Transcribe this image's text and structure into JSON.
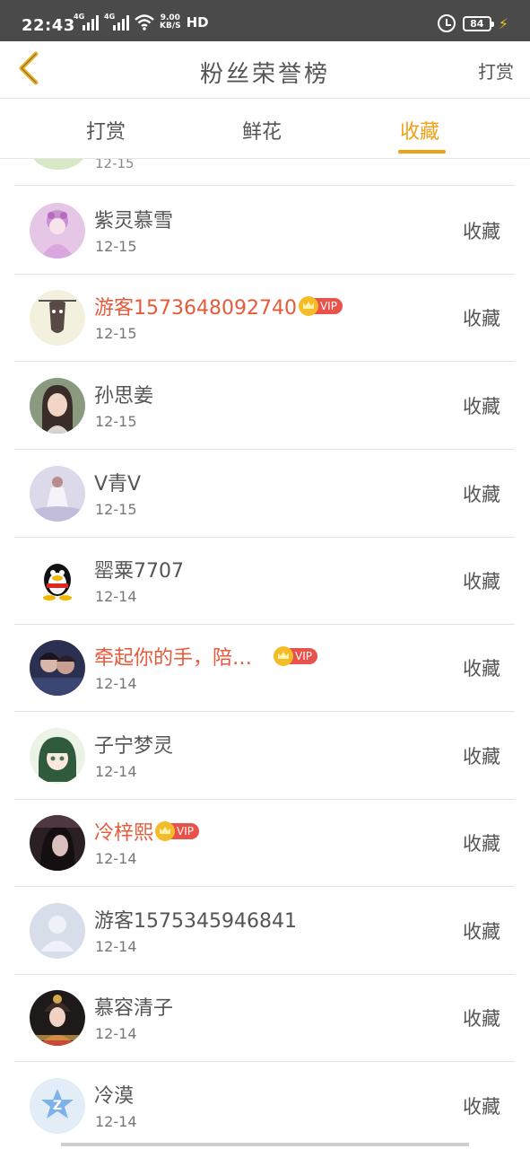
{
  "status_bar": {
    "time": "22:43",
    "net1": "4G",
    "net2": "4G",
    "speed_top": "9.00",
    "speed_bottom": "KB/S",
    "hd": "HD",
    "battery": "84"
  },
  "header": {
    "title": "粉丝荣誉榜",
    "action": "打赏"
  },
  "tabs": [
    {
      "label": "打赏"
    },
    {
      "label": "鲜花"
    },
    {
      "label": "收藏",
      "active": true
    }
  ],
  "colors": {
    "accent": "#f0a015",
    "vip_name": "#e65a3a",
    "vip_tag": "#e8524b"
  },
  "partial_row": {
    "date": "12-15"
  },
  "rows": [
    {
      "name": "紫灵慕雪",
      "date": "12-15",
      "action": "收藏",
      "vip": false,
      "avatar": "purple-girl"
    },
    {
      "name": "游客1573648092740",
      "date": "12-15",
      "action": "收藏",
      "vip": true,
      "vip_label": "VIP",
      "avatar": "bat"
    },
    {
      "name": "孙思姜",
      "date": "12-15",
      "action": "收藏",
      "vip": false,
      "avatar": "girl-photo"
    },
    {
      "name": "V青V",
      "date": "12-15",
      "action": "收藏",
      "vip": false,
      "avatar": "white-dress"
    },
    {
      "name": "罂粟7707",
      "date": "12-14",
      "action": "收藏",
      "vip": false,
      "avatar": "penguin"
    },
    {
      "name": "牵起你的手，陪…",
      "date": "12-14",
      "action": "收藏",
      "vip": true,
      "vip_label": "VIP",
      "avatar": "couple"
    },
    {
      "name": "子宁梦灵",
      "date": "12-14",
      "action": "收藏",
      "vip": false,
      "avatar": "anime-girl"
    },
    {
      "name": "冷梓熙",
      "date": "12-14",
      "action": "收藏",
      "vip": true,
      "vip_label": "VIP",
      "avatar": "dark-girl"
    },
    {
      "name": "游客1575345946841",
      "date": "12-14",
      "action": "收藏",
      "vip": false,
      "avatar": "default-person"
    },
    {
      "name": "慕容清子",
      "date": "12-14",
      "action": "收藏",
      "vip": false,
      "avatar": "ancient-girl"
    },
    {
      "name": "冷漠",
      "date": "12-14",
      "action": "收藏",
      "vip": false,
      "avatar": "qzone-logo"
    }
  ]
}
